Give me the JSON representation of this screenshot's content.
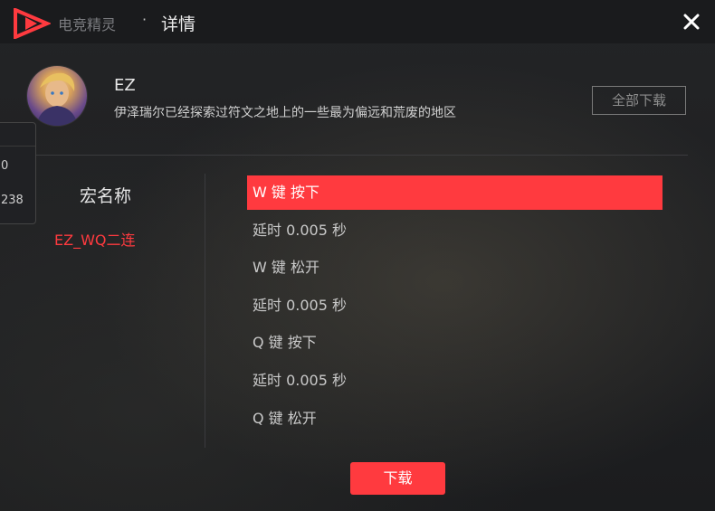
{
  "app": {
    "name": "电竞精灵",
    "separator": "·",
    "page_title": "详情"
  },
  "hero": {
    "name": "EZ",
    "description": "伊泽瑞尔已经探索过符文之地上的一些最为偏远和荒废的地区"
  },
  "buttons": {
    "download_all": "全部下载",
    "download": "下载"
  },
  "side_panel": {
    "values": [
      "0",
      "238"
    ]
  },
  "macro": {
    "heading": "宏名称",
    "items": [
      "EZ_WQ二连"
    ],
    "steps": [
      {
        "label": "W 键 按下",
        "active": true
      },
      {
        "label": "延时 0.005 秒",
        "active": false
      },
      {
        "label": "W 键 松开",
        "active": false
      },
      {
        "label": "延时 0.005 秒",
        "active": false
      },
      {
        "label": "Q 键 按下",
        "active": false
      },
      {
        "label": "延时 0.005 秒",
        "active": false
      },
      {
        "label": "Q 键 松开",
        "active": false
      }
    ]
  },
  "colors": {
    "accent": "#ff3a3f",
    "background": "#1e1f21",
    "titlebar": "#1a1b1d"
  },
  "icons": {
    "logo": "app-logo-icon",
    "close": "close-icon"
  }
}
